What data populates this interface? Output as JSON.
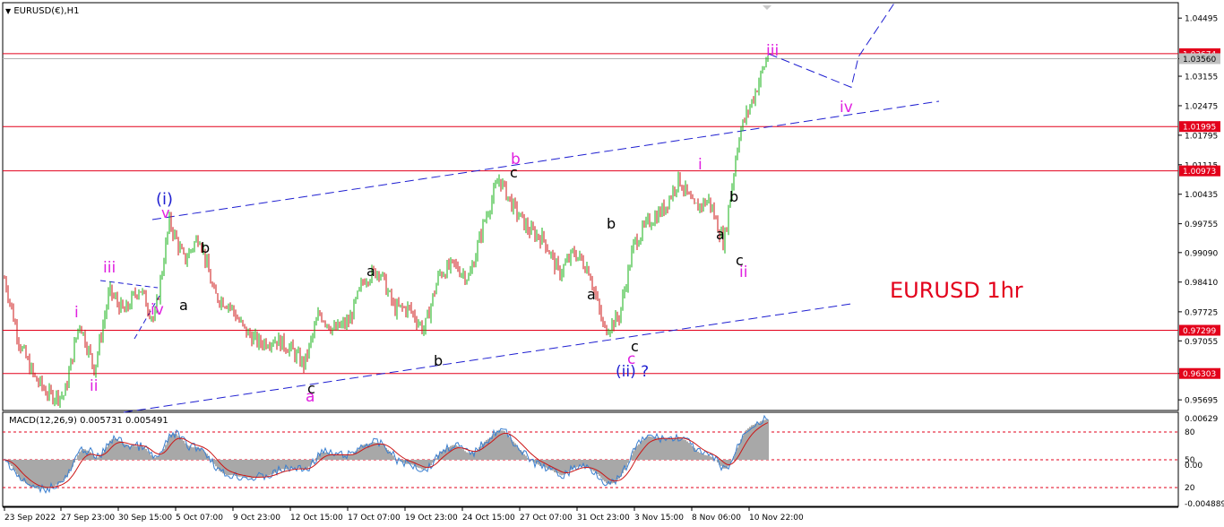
{
  "header": {
    "symbol_label": "EURUSD(€),H1"
  },
  "macd": {
    "label": "MACD(12,26,9) 0.005731 0.005491"
  },
  "chart_title": {
    "text": "EURUSD 1hr",
    "color": "#e3001b"
  },
  "colors": {
    "bull": "#16b216",
    "bear": "#cc1616",
    "level": "#e3001b",
    "channel": "#1f1fd1",
    "wave_magenta": "#e020e0",
    "wave_blue": "#1f1fd1",
    "wave_black": "#000000"
  },
  "chart_data": [
    {
      "type": "candlestick",
      "title": "EURUSD(€),H1",
      "ylim": [
        0.9545,
        1.0485
      ],
      "y_ticks": [
        "1.04495",
        "1.03560",
        "1.03155",
        "1.02475",
        "1.01795",
        "1.01115",
        "1.00435",
        "0.99755",
        "0.99090",
        "0.98410",
        "0.97725",
        "0.97055",
        "0.96303",
        "0.95695"
      ],
      "x_ticks": [
        "23 Sep 2022",
        "27 Sep 23:00",
        "30 Sep 15:00",
        "5 Oct 07:00",
        "9 Oct 23:00",
        "12 Oct 15:00",
        "17 Oct 07:00",
        "19 Oct 23:00",
        "24 Oct 15:00",
        "27 Oct 07:00",
        "31 Oct 23:00",
        "3 Nov 15:00",
        "8 Nov 06:00",
        "10 Nov 22:00"
      ],
      "price_levels": [
        {
          "value": 1.03674,
          "label": "1.03674"
        },
        {
          "value": 1.01995,
          "label": "1.01995"
        },
        {
          "value": 1.00973,
          "label": "1.00973"
        },
        {
          "value": 0.97299,
          "label": "0.97299"
        },
        {
          "value": 0.96303,
          "label": "0.96303"
        }
      ],
      "current_price": {
        "value": 1.0356,
        "label": "1.03560"
      },
      "price_path": [
        [
          "23 Sep 2022",
          0.985
        ],
        [
          "24 Sep",
          0.97
        ],
        [
          "25 Sep",
          0.962
        ],
        [
          "26 Sep",
          0.958
        ],
        [
          "27 Sep",
          0.958
        ],
        [
          "28 Sep",
          0.975
        ],
        [
          "29 Sep",
          0.964
        ],
        [
          "30 Sep",
          0.982
        ],
        [
          "1 Oct",
          0.977
        ],
        [
          "2 Oct",
          0.983
        ],
        [
          "3 Oct",
          0.975
        ],
        [
          "4 Oct",
          0.998
        ],
        [
          "5 Oct",
          0.989
        ],
        [
          "6 Oct",
          0.995
        ],
        [
          "7 Oct",
          0.981
        ],
        [
          "8 Oct",
          0.979
        ],
        [
          "9 Oct",
          0.973
        ],
        [
          "10 Oct",
          0.97
        ],
        [
          "11 Oct",
          0.971
        ],
        [
          "12 Oct",
          0.969
        ],
        [
          "13 Oct",
          0.965
        ],
        [
          "14 Oct",
          0.977
        ],
        [
          "15 Oct",
          0.973
        ],
        [
          "16 Oct",
          0.975
        ],
        [
          "17 Oct",
          0.985
        ],
        [
          "18 Oct",
          0.987
        ],
        [
          "19 Oct",
          0.978
        ],
        [
          "20 Oct",
          0.978
        ],
        [
          "21 Oct",
          0.973
        ],
        [
          "22 Oct",
          0.986
        ],
        [
          "23 Oct",
          0.988
        ],
        [
          "24 Oct",
          0.985
        ],
        [
          "25 Oct",
          0.998
        ],
        [
          "26 Oct",
          1.008
        ],
        [
          "27 Oct",
          1.001
        ],
        [
          "28 Oct",
          0.996
        ],
        [
          "29 Oct",
          0.994
        ],
        [
          "30 Oct",
          0.986
        ],
        [
          "31 Oct",
          0.991
        ],
        [
          "1 Nov",
          0.987
        ],
        [
          "2 Nov",
          0.973
        ],
        [
          "3 Nov",
          0.976
        ],
        [
          "4 Nov",
          0.993
        ],
        [
          "5 Nov",
          0.998
        ],
        [
          "6 Nov",
          1.001
        ],
        [
          "7 Nov",
          1.008
        ],
        [
          "8 Nov",
          1.001
        ],
        [
          "9 Nov",
          1.003
        ],
        [
          "10 Nov",
          0.993
        ],
        [
          "10 Nov 22:00",
          1.018
        ],
        [
          "11 Nov",
          1.027
        ],
        [
          "12 Nov",
          1.037
        ]
      ],
      "projection": [
        [
          "12 Nov",
          1.0367
        ],
        [
          "14 Nov",
          1.029
        ],
        [
          "15 Nov",
          1.036
        ],
        [
          "16 Nov",
          1.049
        ]
      ]
    },
    {
      "type": "line",
      "title": "MACD(12,26,9) 0.005731 0.005491",
      "ylim": [
        -0.004889,
        0.00629
      ],
      "y_ticks": [
        "0.00629",
        "80",
        "50",
        "0.00",
        "20",
        "-0.004889"
      ],
      "reference_levels": [
        80,
        50,
        20
      ]
    }
  ],
  "waves": [
    {
      "text": "(i)",
      "color": "blue"
    },
    {
      "text": "v",
      "color": "magenta"
    },
    {
      "text": "iii",
      "color": "magenta"
    },
    {
      "text": "iv",
      "color": "magenta"
    },
    {
      "text": "i",
      "color": "magenta"
    },
    {
      "text": "ii",
      "color": "magenta"
    },
    {
      "text": "b",
      "color": "black"
    },
    {
      "text": "a",
      "color": "black"
    },
    {
      "text": "a",
      "color": "black"
    },
    {
      "text": "c",
      "color": "black"
    },
    {
      "text": "a",
      "color": "magenta"
    },
    {
      "text": "b",
      "color": "black"
    },
    {
      "text": "c",
      "color": "black"
    },
    {
      "text": "b",
      "color": "magenta"
    },
    {
      "text": "a",
      "color": "black"
    },
    {
      "text": "b",
      "color": "black"
    },
    {
      "text": "c",
      "color": "black"
    },
    {
      "text": "c",
      "color": "magenta"
    },
    {
      "text": "(ii) ?",
      "color": "blue"
    },
    {
      "text": "i",
      "color": "magenta"
    },
    {
      "text": "a",
      "color": "black"
    },
    {
      "text": "b",
      "color": "black"
    },
    {
      "text": "c",
      "color": "black"
    },
    {
      "text": "ii",
      "color": "magenta"
    },
    {
      "text": "iii",
      "color": "magenta"
    },
    {
      "text": "iv",
      "color": "magenta"
    }
  ]
}
